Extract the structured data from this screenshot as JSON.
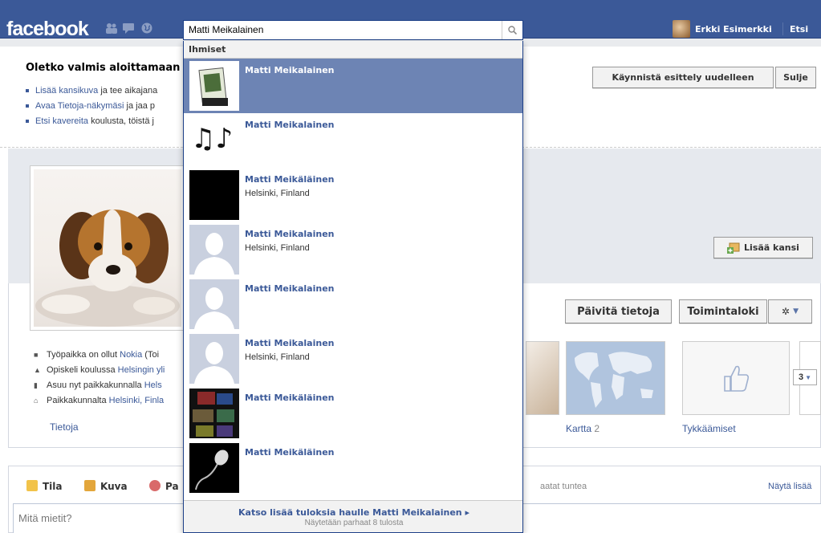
{
  "topbar": {
    "logo": "facebook",
    "search_value": "Matti Meikalainen",
    "user_name": "Erkki Esimerkki",
    "find_label": "Etsi"
  },
  "tour": {
    "title": "Oletko valmis aloittamaan",
    "line1_link": "Lisää kansikuva",
    "line1_text": " ja tee aikajana",
    "line2_link": "Avaa Tietoja-näkymäsi",
    "line2_text": " ja jaa p",
    "line3_link": "Etsi kavereita",
    "line3_text": " koulusta, töistä j",
    "restart_label": "Käynnistä esittely uudelleen",
    "close_label": "Sulje"
  },
  "profile": {
    "add_cover_label": "Lisää kansi",
    "update_info_label": "Päivitä tietoja",
    "activity_log_label": "Toimintaloki",
    "info": [
      {
        "text": "Työpaikka on ollut ",
        "link": "Nokia",
        "suffix": " (Toi"
      },
      {
        "text": "Opiskeli koulussa ",
        "link": "Helsingin yli",
        "suffix": ""
      },
      {
        "text": "Asuu nyt paikkakunnalla ",
        "link": "Hels",
        "suffix": ""
      },
      {
        "text": "Paikkakunnalta ",
        "link": "Helsinki, Finla",
        "suffix": ""
      }
    ],
    "about_label": "Tietoja",
    "map_label": "Kartta",
    "map_count": "2",
    "likes_label": "Tykkäämiset",
    "more_count": "3"
  },
  "composer": {
    "status_label": "Tila",
    "photo_label": "Kuva",
    "place_label": "Pa",
    "friends_hint": "aatat tuntea",
    "show_more": "Näytä lisää",
    "placeholder": "Mitä mietit?"
  },
  "dropdown": {
    "section_label": "Ihmiset",
    "results": [
      {
        "name": "Matti Meikalainen",
        "sub": ""
      },
      {
        "name": "Matti Meikalainen",
        "sub": ""
      },
      {
        "name": "Matti Meikäläinen",
        "sub": "Helsinki, Finland"
      },
      {
        "name": "Matti Meikalainen",
        "sub": "Helsinki, Finland"
      },
      {
        "name": "Matti Meikalainen",
        "sub": ""
      },
      {
        "name": "Matti Meikalainen",
        "sub": "Helsinki, Finland"
      },
      {
        "name": "Matti Meikäläinen",
        "sub": ""
      },
      {
        "name": "Matti Meikäläinen",
        "sub": ""
      }
    ],
    "see_more": "Katso lisää tuloksia haulle Matti Meikalainen ▸",
    "shown_count": "Näytetään parhaat 8 tulosta"
  },
  "colors": {
    "brand_blue": "#3b5998",
    "selected_row": "#6d84b4"
  }
}
